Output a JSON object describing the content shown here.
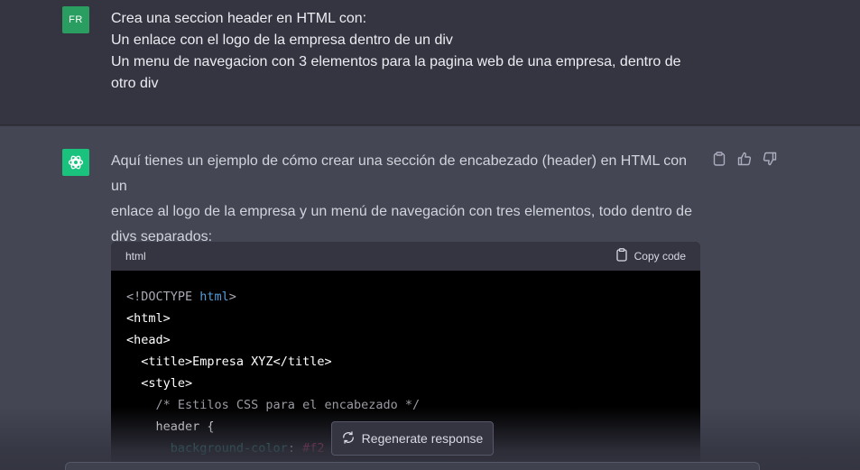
{
  "user_message": {
    "avatar_initials": "FR",
    "lines": [
      "Crea una seccion header en HTML con:",
      "Un enlace con el logo de la empresa dentro de un div",
      "Un menu de navegacion con 3 elementos para la pagina web de una empresa,  dentro de",
      "otro div"
    ]
  },
  "assistant_message": {
    "intro_lines": [
      "Aquí tienes un ejemplo de cómo crear una sección de encabezado (header) en HTML con un",
      "enlace al logo de la empresa y un menú de navegación con tres elementos, todo dentro de",
      "divs separados:"
    ],
    "icons": [
      "clipboard-icon",
      "thumbs-up-icon",
      "thumbs-down-icon"
    ]
  },
  "code_block": {
    "language": "html",
    "copy_label": "Copy code",
    "lines": {
      "l1_a": "<!DOCTYPE ",
      "l1_b": "html",
      "l1_c": ">",
      "l2": "<html>",
      "l3": "<head>",
      "l4_a": "  <title>",
      "l4_b": "Empresa XYZ",
      "l4_c": "</title>",
      "l5": "  <style>",
      "l6": "    /* Estilos CSS para el encabezado */",
      "l7": "    header {",
      "l8_a": "      background-color",
      "l8_b": ": ",
      "l8_c": "#f2"
    }
  },
  "regenerate_label": "Regenerate response",
  "colors": {
    "user_bg": "#343541",
    "assistant_bg": "#444654",
    "user_avatar": "#2a9d61",
    "bot_avatar": "#19c37d",
    "code_bg": "#000000"
  }
}
